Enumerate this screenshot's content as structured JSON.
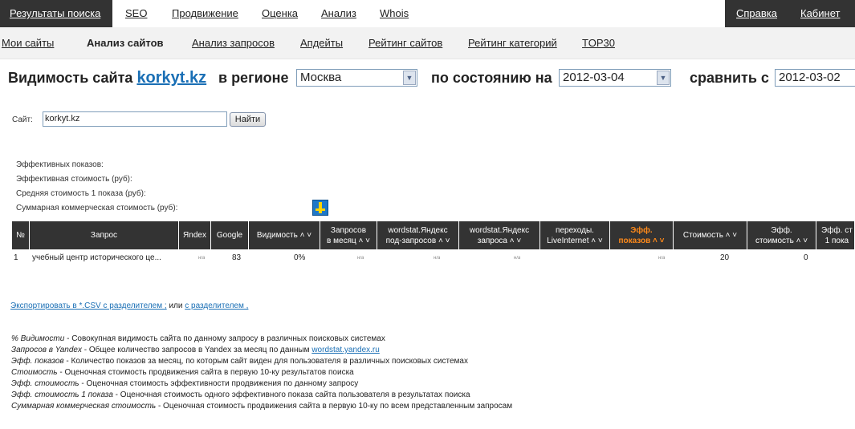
{
  "topnav": {
    "items": [
      "Результаты поиска",
      "SEO",
      "Продвижение",
      "Оценка",
      "Анализ",
      "Whois"
    ],
    "right": [
      "Справка",
      "Кабинет"
    ]
  },
  "subnav": {
    "items": [
      "Мои сайты",
      "Анализ сайтов",
      "Анализ запросов",
      "Апдейты",
      "Рейтинг сайтов",
      "Рейтинг категорий",
      "TOP30"
    ],
    "active": "Анализ сайтов"
  },
  "heading": {
    "visibility_label": "Видимость сайта",
    "site": "korkyt.kz",
    "region_label": "в регионе",
    "region_value": "Москва",
    "state_label": "по состоянию на",
    "state_date": "2012-03-04",
    "compare_label": "сравнить с",
    "compare_date": "2012-03-02"
  },
  "form": {
    "site_label": "Сайт:",
    "site_value": "korkyt.kz",
    "find_button": "Найти"
  },
  "summary": [
    "Эффективных показов:",
    "Эффективная стоимость (руб):",
    "Средняя стоимость 1 показа (руб):",
    "Суммарная коммерческая стоимость (руб):"
  ],
  "table": {
    "headers": [
      "№",
      "Запрос",
      "Яndex",
      "Google",
      "Видимость ˄ ˅",
      "Запросов\nв месяц ˄ ˅",
      "wordstat.Яндекс\nпод-запросов ˄ ˅",
      "wordstat.Яндекс\nзапроса ˄ ˅",
      "переходы.\nLiveInternet ˄ ˅",
      "Эфф.\nпоказов ˄ ˅",
      "Стоимость ˄ ˅",
      "Эфф.\nстоимость ˄ ˅",
      "Эфф. ст\n1 пока"
    ],
    "rows": [
      {
        "num": "1",
        "query": "учебный центр исторического це...",
        "yandex": "н/а",
        "google": "83",
        "visibility": "0%",
        "monthly": "н/а",
        "wordstat_sub": "н/а",
        "wordstat_q": "н/а",
        "liveinternet": "",
        "eff_shows": "н/а",
        "cost": "20",
        "eff_cost": "0",
        "eff_cost_1": ""
      }
    ]
  },
  "export": {
    "link1": "Экспортировать в *.CSV с разделителем ;",
    "or": "или",
    "link2": "с разделителем ,"
  },
  "legend": [
    {
      "term": "% Видимости",
      "text": " - Совокупная видимость сайта по данному запросу в различных поисковых системах"
    },
    {
      "term": "Запросов в Yandex",
      "text": " - Общее количество запросов в Yandex за месяц по данным ",
      "link": "wordstat.yandex.ru"
    },
    {
      "term": "Эфф. показов",
      "text": " - Количество показов за месяц, по которым сайт виден для пользователя в различных поисковых системах"
    },
    {
      "term": "Стоимость",
      "text": " - Оценочная стоимость продвижения сайта в первую 10-ку результатов поиска"
    },
    {
      "term": "Эфф. стоимость",
      "text": " - Оценочная стоимость эффективности продвижения по данному запросу"
    },
    {
      "term": "Эфф. стоимость 1 показа",
      "text": " - Оценочная стоимость одного эффективного показа сайта пользователя в результатах поиска"
    },
    {
      "term": "Суммарная коммерческая стоимость",
      "text": " - Оценочная стоимость продвижения сайта в первую 10-ку по всем представленным запросам"
    }
  ]
}
